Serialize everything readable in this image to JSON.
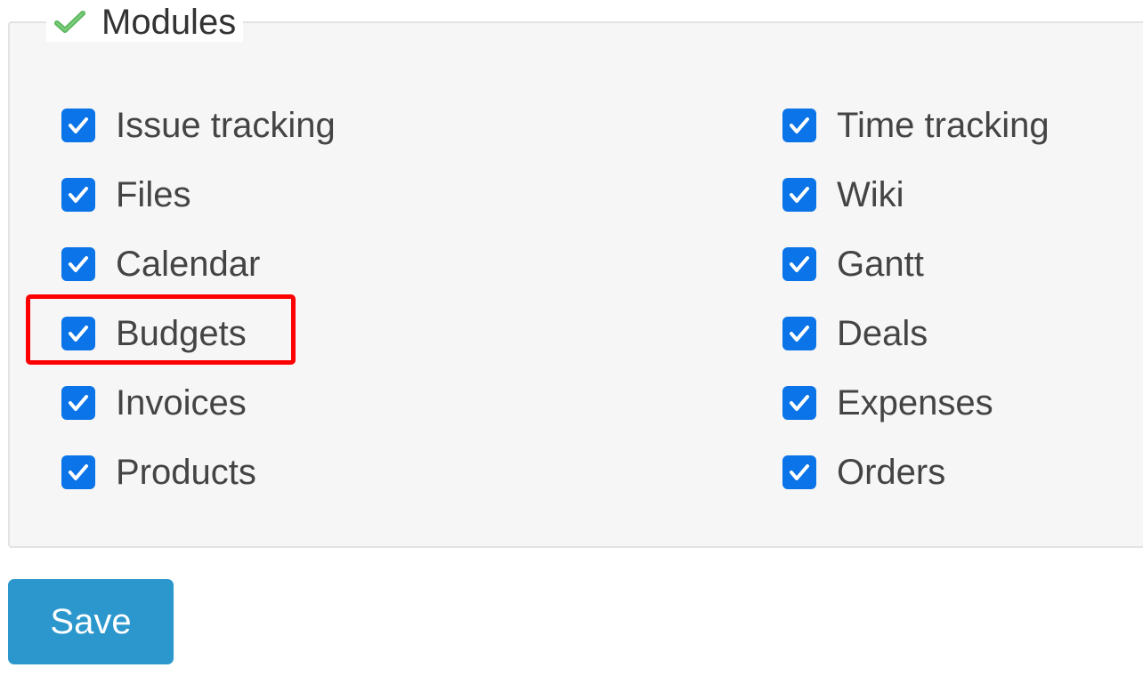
{
  "fieldset": {
    "legend": "Modules",
    "legend_icon": "green-checkmark-icon"
  },
  "modules": {
    "left": [
      {
        "label": "Issue tracking",
        "checked": true
      },
      {
        "label": "Files",
        "checked": true
      },
      {
        "label": "Calendar",
        "checked": true
      },
      {
        "label": "Budgets",
        "checked": true
      },
      {
        "label": "Invoices",
        "checked": true
      },
      {
        "label": "Products",
        "checked": true
      }
    ],
    "right": [
      {
        "label": "Time tracking",
        "checked": true
      },
      {
        "label": "Wiki",
        "checked": true
      },
      {
        "label": "Gantt",
        "checked": true
      },
      {
        "label": "Deals",
        "checked": true
      },
      {
        "label": "Expenses",
        "checked": true
      },
      {
        "label": "Orders",
        "checked": true
      }
    ]
  },
  "actions": {
    "save_label": "Save"
  },
  "colors": {
    "checkbox": "#0a74e8",
    "save_button": "#2b97cc",
    "highlight": "#ff0000",
    "legend_check": "#5cb85c"
  }
}
